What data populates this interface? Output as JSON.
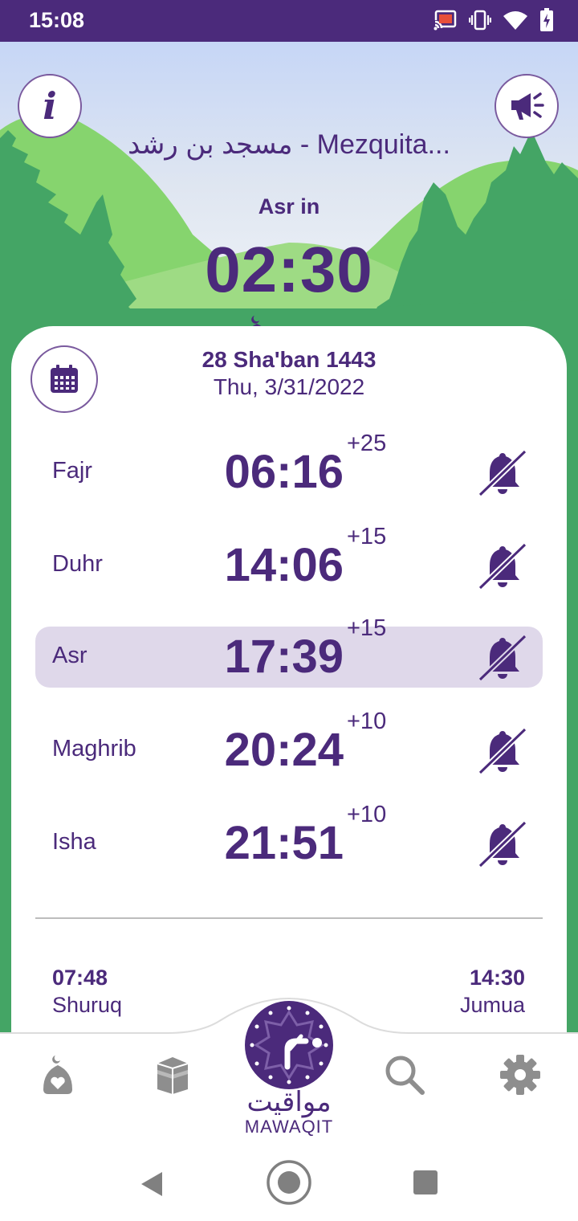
{
  "status_bar": {
    "time": "15:08",
    "icons": [
      "cast-icon",
      "vibrate-icon",
      "wifi-icon",
      "battery-charging-icon"
    ]
  },
  "header": {
    "mosque_name": "مسجد بن رشد - Mezquita...",
    "info_icon": "info-icon",
    "announce_icon": "megaphone-icon"
  },
  "countdown": {
    "label": "Asr in",
    "value": "02:30"
  },
  "pager": {
    "pages": 3,
    "active": 0
  },
  "dates": {
    "hijri": "28 Sha'ban 1443",
    "gregorian": "Thu, 3/31/2022"
  },
  "prayers": [
    {
      "name": "Fajr",
      "time": "06:16",
      "iqama": "+25",
      "bell": "bell-muted-icon",
      "active": false
    },
    {
      "name": "Duhr",
      "time": "14:06",
      "iqama": "+15",
      "bell": "bell-muted-icon",
      "active": false
    },
    {
      "name": "Asr",
      "time": "17:39",
      "iqama": "+15",
      "bell": "bell-muted-icon",
      "active": true
    },
    {
      "name": "Maghrib",
      "time": "20:24",
      "iqama": "+10",
      "bell": "bell-muted-icon",
      "active": false
    },
    {
      "name": "Isha",
      "time": "21:51",
      "iqama": "+10",
      "bell": "bell-muted-icon",
      "active": false
    }
  ],
  "extras": {
    "shuruq": {
      "time": "07:48",
      "label": "Shuruq"
    },
    "jumua": {
      "time": "14:30",
      "label": "Jumua"
    }
  },
  "bottom_nav": {
    "logo_arabic": "مواقيت",
    "logo_latin": "MAWAQIT",
    "items": [
      "mosque-heart-icon",
      "kaaba-icon",
      "mawaqit-logo",
      "search-icon",
      "settings-icon"
    ]
  },
  "colors": {
    "primary": "#4b2a7b",
    "green": "#44a565",
    "light_green": "#86d46e",
    "highlight": "#dfd8ea",
    "nav_icon": "#8e8e8e"
  }
}
